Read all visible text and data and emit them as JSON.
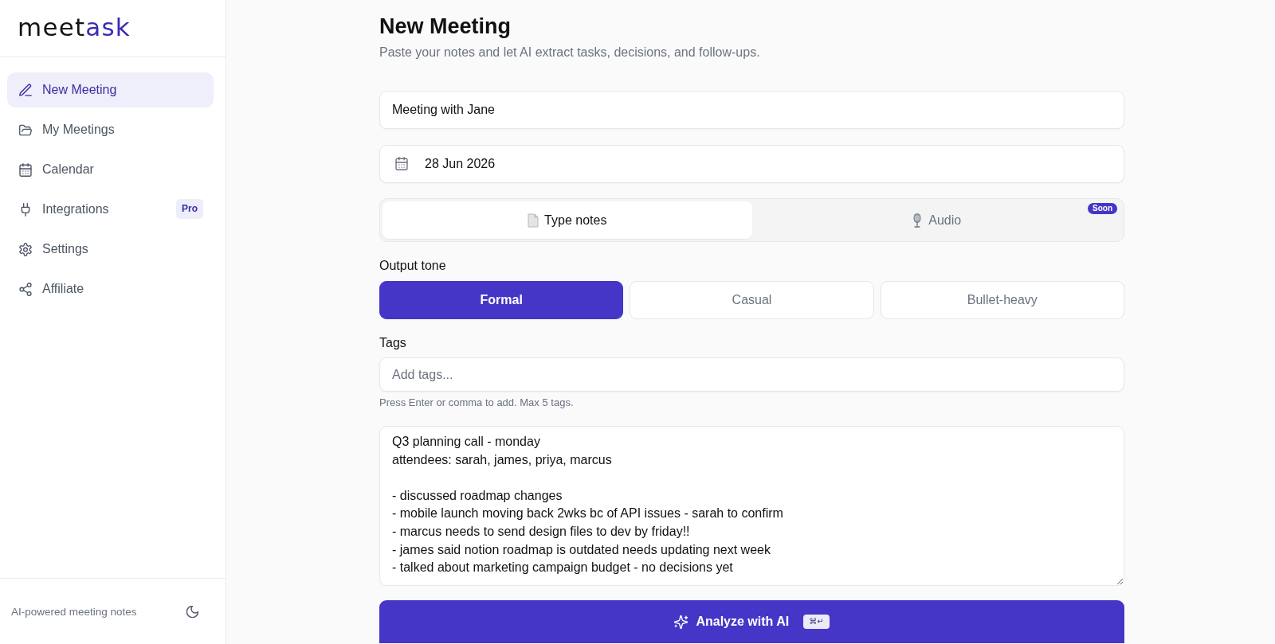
{
  "sidebar": {
    "logo": [
      {
        "text": "meet",
        "accent": false
      },
      {
        "text": "ask",
        "accent": true
      }
    ],
    "items": [
      {
        "label": "New Meeting",
        "selected": true
      },
      {
        "label": "My Meetings",
        "selected": false
      },
      {
        "label": "Calendar",
        "selected": false
      },
      {
        "label": "Integrations",
        "selected": false,
        "badge": "Pro"
      },
      {
        "label": "Settings",
        "selected": false
      },
      {
        "label": "Affiliate",
        "selected": false
      }
    ],
    "footer": {
      "text": "AI-powered meeting notes"
    }
  },
  "header": {
    "title": "New Meeting",
    "subtitle": "Paste your notes and let AI extract tasks, decisions, and follow-ups."
  },
  "form": {
    "title_field": {
      "value": "Meeting with Jane"
    },
    "date_field": {
      "value": "28 Jun 2026"
    },
    "input_modes": [
      {
        "label": "Type notes",
        "selected": true
      },
      {
        "label": "Audio",
        "selected": false,
        "badge": "Soon"
      }
    ],
    "output_tone": {
      "label": "Output tone",
      "options": [
        {
          "label": "Formal",
          "selected": true
        },
        {
          "label": "Casual",
          "selected": false
        },
        {
          "label": "Bullet-heavy",
          "selected": false
        }
      ]
    },
    "tags": {
      "label": "Tags",
      "placeholder": "Add tags...",
      "hint": "Press Enter or comma to add. Max 5 tags."
    },
    "notes": {
      "value": "Q3 planning call - monday\nattendees: sarah, james, priya, marcus\n\n- discussed roadmap changes\n- mobile launch moving back 2wks bc of API issues - sarah to confirm\n- marcus needs to send design files to dev by friday!!\n- james said notion roadmap is outdated needs updating next week\n- talked about marketing campaign budget - no decisions yet"
    },
    "analyze_button": {
      "label": "Analyze with AI",
      "shortcut": "⌘↵"
    }
  }
}
